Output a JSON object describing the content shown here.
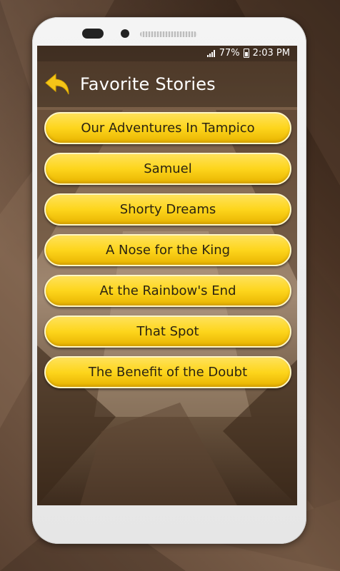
{
  "status_bar": {
    "battery_percent": "77%",
    "time": "2:03 PM"
  },
  "header": {
    "title": "Favorite Stories",
    "back_icon": "back-arrow-icon",
    "back_icon_color": "#f4c518"
  },
  "stories": [
    {
      "label": "Our Adventures In Tampico"
    },
    {
      "label": "Samuel"
    },
    {
      "label": "Shorty Dreams"
    },
    {
      "label": "A Nose for the King"
    },
    {
      "label": "At the Rainbow's End"
    },
    {
      "label": "That Spot"
    },
    {
      "label": "The Benefit of the Doubt"
    }
  ],
  "colors": {
    "button_fill": "#fdd51c",
    "button_border": "#fff6c4",
    "button_text": "#2b2312"
  }
}
